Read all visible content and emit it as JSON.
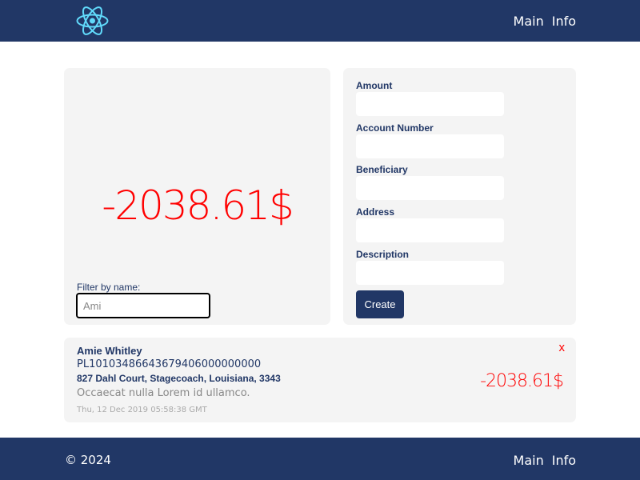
{
  "header": {
    "logo_icon": "react-atom-icon",
    "nav": [
      {
        "label": "Main"
      },
      {
        "label": "Info"
      }
    ]
  },
  "balance": {
    "value": "-2038.61$",
    "color": "#ff0000"
  },
  "filter": {
    "label": "Filter by name:",
    "value": "Ami"
  },
  "form": {
    "fields": [
      {
        "label": "Amount"
      },
      {
        "label": "Account Number"
      },
      {
        "label": "Beneficiary"
      },
      {
        "label": "Address"
      },
      {
        "label": "Description"
      }
    ],
    "submit_label": "Create"
  },
  "transactions": [
    {
      "name": "Amie Whitley",
      "account": "PL10103486643679406000000000",
      "address": "827 Dahl Court, Stagecoach, Louisiana, 3343",
      "description": "Occaecat nulla Lorem id ullamco.",
      "date": "Thu, 12 Dec 2019 05:58:38 GMT",
      "amount": "-2038.61$",
      "delete_label": "x"
    }
  ],
  "footer": {
    "copyright": "© 2024",
    "nav": [
      {
        "label": "Main"
      },
      {
        "label": "Info"
      }
    ]
  },
  "colors": {
    "primary": "#213766",
    "negative": "#ff0000",
    "panel": "#f4f4f4"
  }
}
